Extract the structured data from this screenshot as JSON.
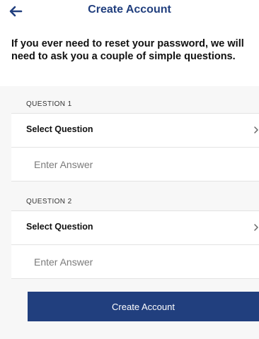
{
  "header": {
    "title": "Create Account",
    "back_icon": "arrow-left-icon"
  },
  "intro": {
    "text": "If you ever need to reset your password, we will need to ask you a couple of simple questions."
  },
  "questions": [
    {
      "section_label": "QUESTION 1",
      "select_label": "Select Question",
      "answer_placeholder": "Enter Answer",
      "chevron_icon": "chevron-right-icon"
    },
    {
      "section_label": "QUESTION 2",
      "select_label": "Select Question",
      "answer_placeholder": "Enter Answer",
      "chevron_icon": "chevron-right-icon"
    }
  ],
  "footer": {
    "create_label": "Create Account"
  },
  "colors": {
    "accent": "#213f7e",
    "background": "#ffffff",
    "section_background": "#f7f7f7"
  }
}
